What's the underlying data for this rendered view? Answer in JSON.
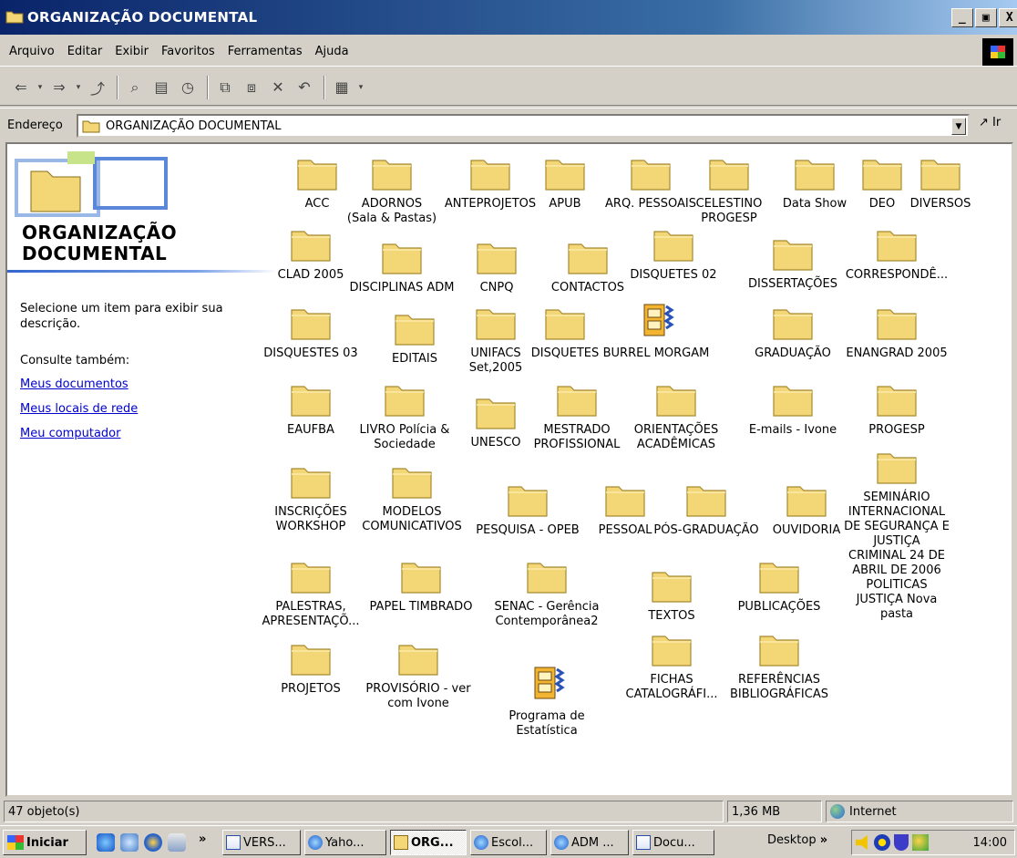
{
  "window": {
    "title": "ORGANIZAÇÃO DOCUMENTAL",
    "controls": {
      "minimize": "_",
      "maximize": "ð",
      "close": "X"
    }
  },
  "menu": [
    "Arquivo",
    "Editar",
    "Exibir",
    "Favoritos",
    "Ferramentas",
    "Ajuda"
  ],
  "address": {
    "label": "Endereço",
    "value": "ORGANIZAÇÃO DOCUMENTAL",
    "go_label": "Ir"
  },
  "left_pane": {
    "title": "ORGANIZAÇÃO DOCUMENTAL",
    "description": "Selecione um item para exibir sua descrição.",
    "see_also": "Consulte também:",
    "links": [
      "Meus documentos",
      "Meus locais de rede",
      "Meu computador"
    ]
  },
  "items": [
    {
      "label": "ACC",
      "type": "folder"
    },
    {
      "label": "ADORNOS\n(Sala & Pastas)",
      "type": "folder"
    },
    {
      "label": "ANTEPROJETOS",
      "type": "folder"
    },
    {
      "label": "APUB",
      "type": "folder"
    },
    {
      "label": "ARQ. PESSOAIS",
      "type": "folder"
    },
    {
      "label": "CELESTINO\nPROGESP",
      "type": "folder"
    },
    {
      "label": "Data Show",
      "type": "folder"
    },
    {
      "label": "DEO",
      "type": "folder"
    },
    {
      "label": "DIVERSOS",
      "type": "folder"
    },
    {
      "label": "CLAD 2005",
      "type": "folder"
    },
    {
      "label": "DISCIPLINAS ADM",
      "type": "folder"
    },
    {
      "label": "CNPQ",
      "type": "folder"
    },
    {
      "label": "CONTACTOS",
      "type": "folder"
    },
    {
      "label": "DISQUETES 02",
      "type": "folder"
    },
    {
      "label": "DISSERTAÇÕES",
      "type": "folder"
    },
    {
      "label": "CORRESPONDÊ...",
      "type": "folder"
    },
    {
      "label": "DISQUESTES 03",
      "type": "folder"
    },
    {
      "label": "EDITAIS",
      "type": "folder"
    },
    {
      "label": "UNIFACS\nSet,2005",
      "type": "folder"
    },
    {
      "label": "DISQUETES",
      "type": "folder"
    },
    {
      "label": "BURREL MORGAM",
      "type": "archive"
    },
    {
      "label": "GRADUAÇÃO",
      "type": "folder"
    },
    {
      "label": "ENANGRAD 2005",
      "type": "folder"
    },
    {
      "label": "EAUFBA",
      "type": "folder"
    },
    {
      "label": "LIVRO Polícia &\nSociedade",
      "type": "folder"
    },
    {
      "label": "UNESCO",
      "type": "folder"
    },
    {
      "label": "MESTRADO\nPROFISSIONAL",
      "type": "folder"
    },
    {
      "label": "ORIENTAÇÕES\nACADÊMICAS",
      "type": "folder"
    },
    {
      "label": "E-mails - Ivone",
      "type": "folder"
    },
    {
      "label": "PROGESP",
      "type": "folder"
    },
    {
      "label": "INSCRIÇÕES\nWORKSHOP",
      "type": "folder"
    },
    {
      "label": "MODELOS\nCOMUNICATIVOS",
      "type": "folder"
    },
    {
      "label": "PESQUISA - OPEB",
      "type": "folder"
    },
    {
      "label": "PESSOAL",
      "type": "folder"
    },
    {
      "label": "PÓS-GRADUAÇÃO",
      "type": "folder"
    },
    {
      "label": "OUVIDORIA",
      "type": "folder"
    },
    {
      "label": "SEMINÁRIO\nINTERNACIONAL\nDE SEGURANÇA E\nJUSTIÇA\nCRIMINAL 24 DE\nABRIL DE 2006\nPOLITICAS\nJUSTIÇA Nova\npasta",
      "type": "folder"
    },
    {
      "label": "PALESTRAS,\nAPRESENTAÇÕ...",
      "type": "folder"
    },
    {
      "label": "PAPEL TIMBRADO",
      "type": "folder"
    },
    {
      "label": "SENAC - Gerência\nContemporânea2",
      "type": "folder"
    },
    {
      "label": "TEXTOS",
      "type": "folder"
    },
    {
      "label": "PUBLICAÇÕES",
      "type": "folder"
    },
    {
      "label": "PROJETOS",
      "type": "folder"
    },
    {
      "label": "PROVISÓRIO - ver\ncom Ivone",
      "type": "folder"
    },
    {
      "label": "Programa de\nEstatística",
      "type": "archive"
    },
    {
      "label": "FICHAS\nCATALOGRÁFI...",
      "type": "folder"
    },
    {
      "label": "REFERÊNCIAS\nBIBLIOGRÁFICAS",
      "type": "folder"
    }
  ],
  "status": {
    "objects": "47 objeto(s)",
    "size": "1,36 MB",
    "zone": "Internet"
  },
  "taskbar": {
    "start": "Iniciar",
    "chevron": "»",
    "tasks": [
      "VERS...",
      "Yaho...",
      "ORG...",
      "Escol...",
      "ADM ...",
      "Docu..."
    ],
    "desktop": "Desktop",
    "clock": "14:00"
  }
}
